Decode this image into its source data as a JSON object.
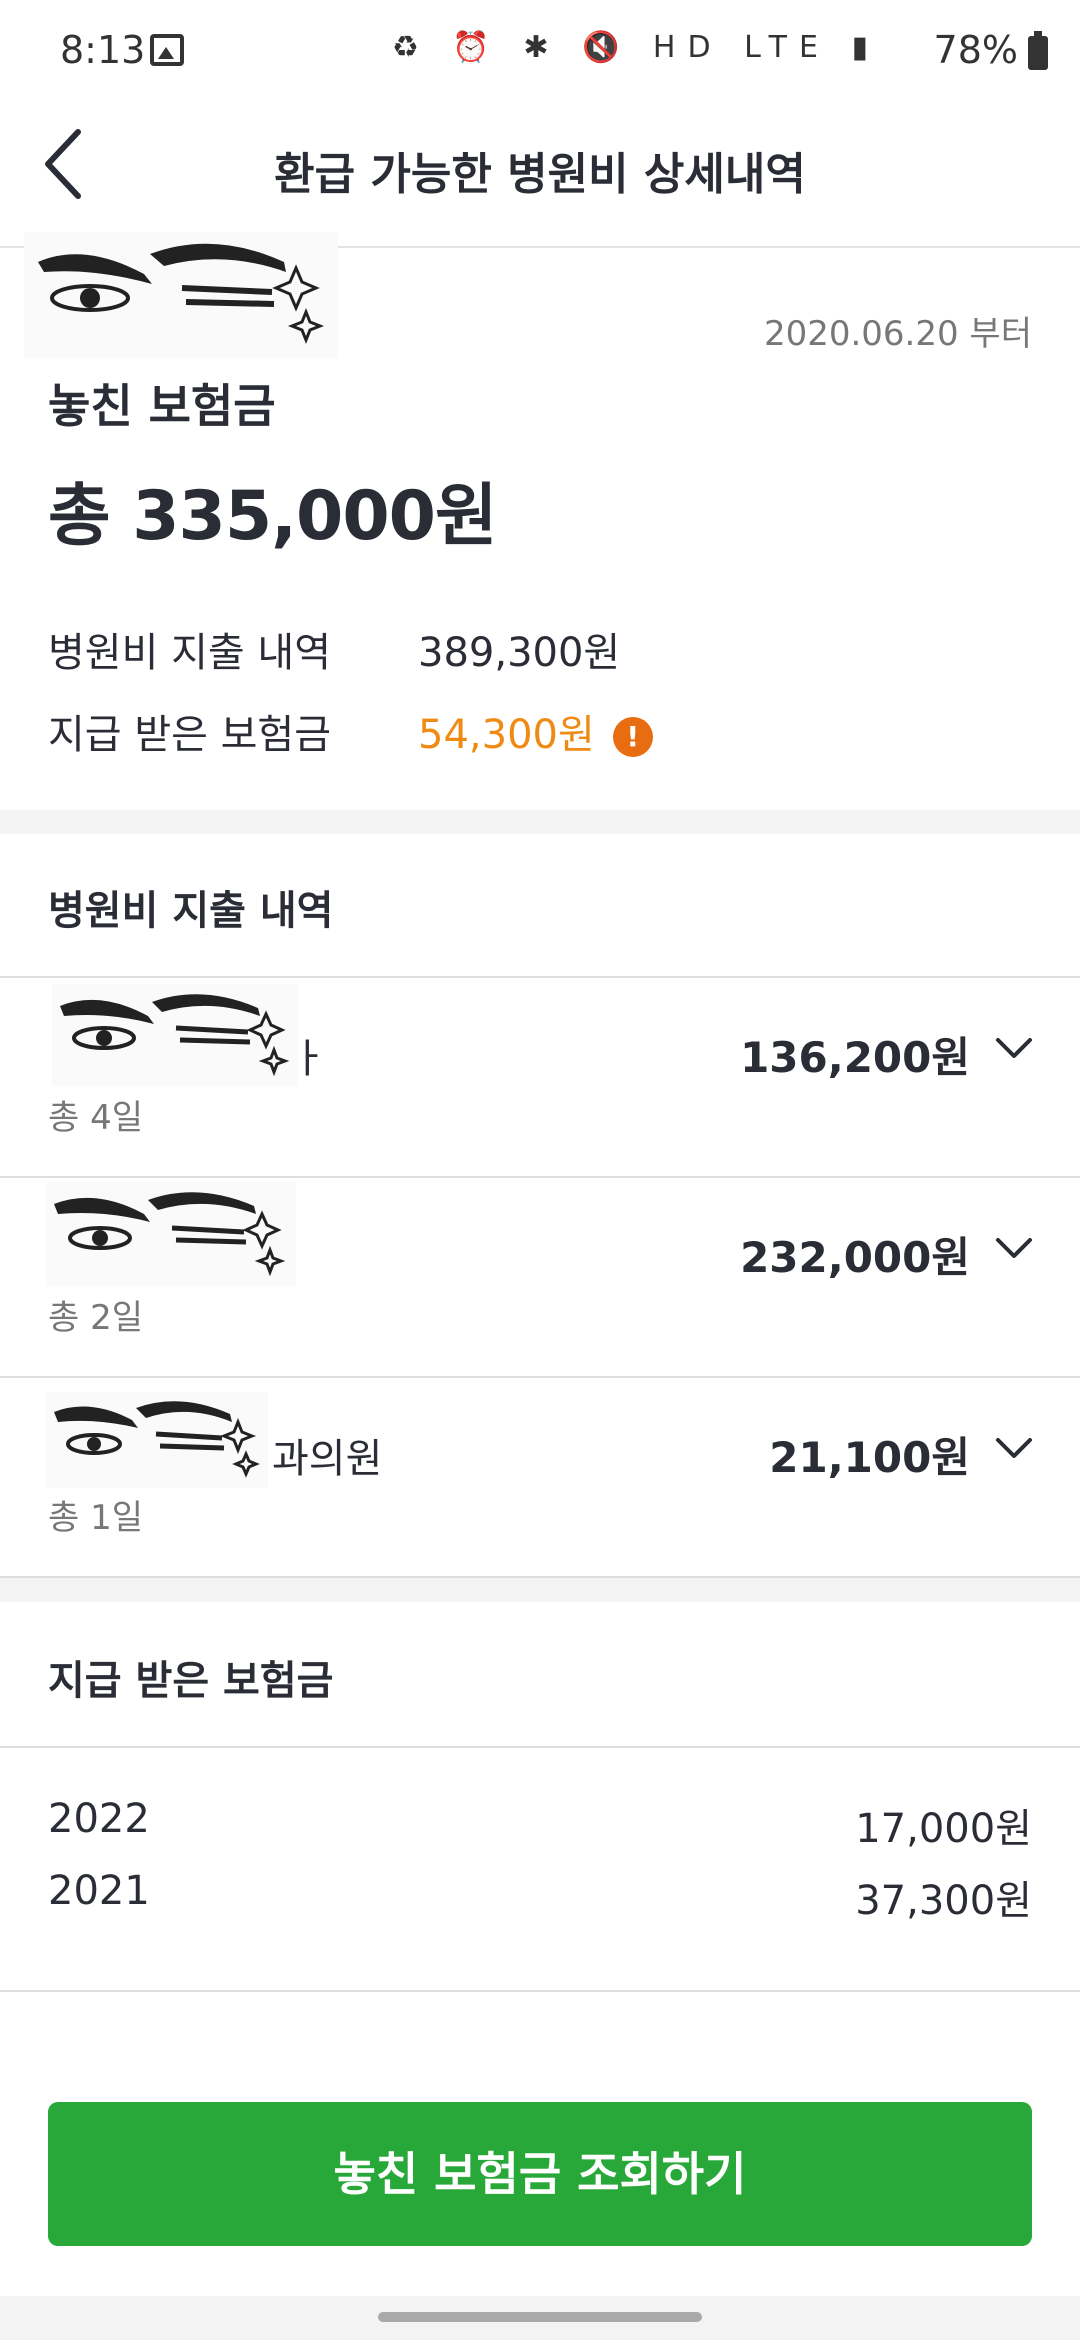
{
  "status_bar": {
    "time": "8:13",
    "icons": "♻ ⏰ ✱ 🔇 HD LTE ▮",
    "battery_pct": "78%"
  },
  "header": {
    "title": "환급 가능한 병원비 상세내역"
  },
  "summary": {
    "since_date": "2020.06.20 부터",
    "label": "놓친 보험금",
    "total": "총 335,000원",
    "rows": [
      {
        "key": "병원비 지출 내역",
        "value": "389,300원"
      },
      {
        "key": "지급 받은 보험금",
        "value": "54,300원"
      }
    ],
    "warning_glyph": "!"
  },
  "hospital_section": {
    "title": "병원비 지출 내역",
    "items": [
      {
        "name_suffix": "ㅏ",
        "days": "총 4일",
        "amount": "136,200원"
      },
      {
        "name_suffix": "",
        "days": "총 2일",
        "amount": "232,000원"
      },
      {
        "name_suffix": "과의원",
        "days": "총 1일",
        "amount": "21,100원"
      }
    ]
  },
  "paid_section": {
    "title": "지급 받은 보험금",
    "rows": [
      {
        "year": "2022",
        "amount": "17,000원"
      },
      {
        "year": "2021",
        "amount": "37,300원"
      }
    ]
  },
  "cta": {
    "label": "놓친 보험금 조회하기"
  },
  "colors": {
    "accent_green": "#28a838",
    "highlight_orange": "#ef8a14",
    "warning_orange": "#e86d10"
  }
}
